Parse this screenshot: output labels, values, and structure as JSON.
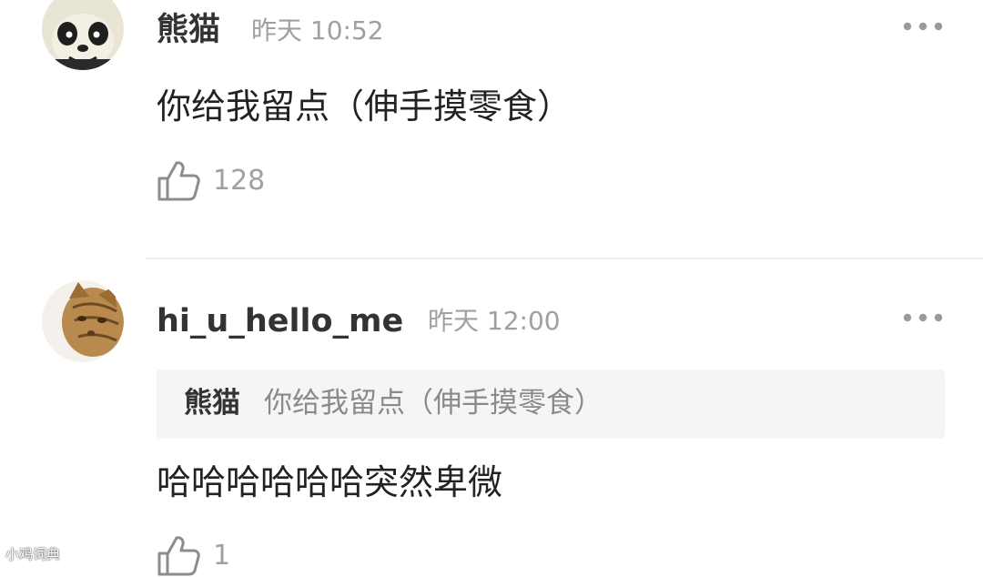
{
  "comments": [
    {
      "username": "熊猫",
      "time": "昨天 10:52",
      "avatar_icon": "panda-avatar",
      "text": "你给我留点（伸手摸零食）",
      "likes": "128"
    },
    {
      "username": "hi_u_hello_me",
      "time": "昨天 12:00",
      "avatar_icon": "cat-avatar",
      "quote": {
        "username": "熊猫",
        "text": "你给我留点（伸手摸零食）"
      },
      "text": "哈哈哈哈哈哈突然卑微",
      "likes": "1"
    }
  ],
  "watermark": "小鸡词典"
}
